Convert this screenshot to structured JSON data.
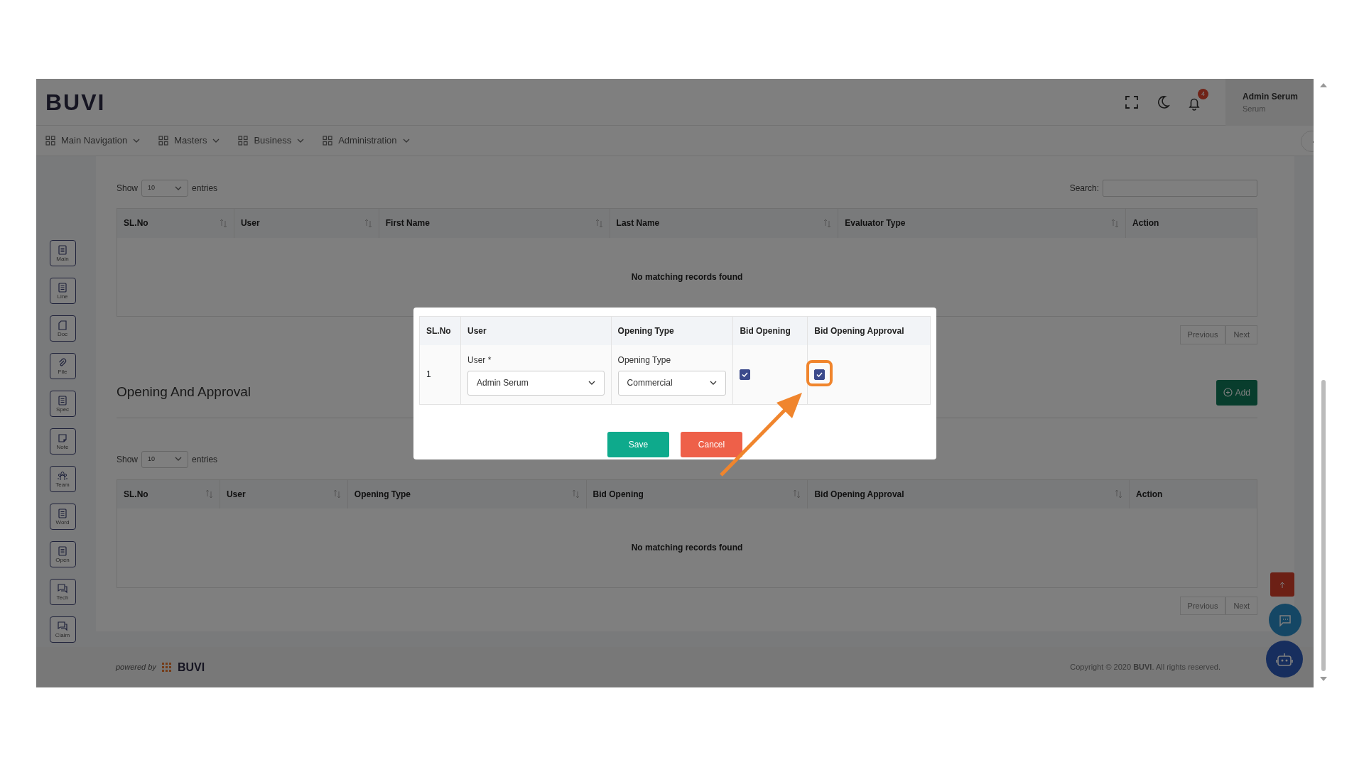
{
  "header": {
    "logo": "BUVI",
    "notification_count": "4",
    "user_name": "Admin Serum",
    "user_role": "Serum"
  },
  "nav": [
    {
      "label": "Main Navigation"
    },
    {
      "label": "Masters"
    },
    {
      "label": "Business"
    },
    {
      "label": "Administration"
    }
  ],
  "sidebar": [
    {
      "label": "Main",
      "kind": "list"
    },
    {
      "label": "Line",
      "kind": "list"
    },
    {
      "label": "Doc",
      "kind": "page"
    },
    {
      "label": "File",
      "kind": "clip"
    },
    {
      "label": "Spec",
      "kind": "list"
    },
    {
      "label": "Note",
      "kind": "note"
    },
    {
      "label": "Team",
      "kind": "team"
    },
    {
      "label": "Word",
      "kind": "list"
    },
    {
      "label": "Open",
      "kind": "list"
    },
    {
      "label": "Tech",
      "kind": "chat"
    },
    {
      "label": "Claim",
      "kind": "chat"
    }
  ],
  "evaluators": {
    "show_label": "Show",
    "page_size": "10",
    "entries_label": "entries",
    "search_label": "Search:",
    "columns": [
      {
        "label": "SL.No",
        "sortable": true
      },
      {
        "label": "User",
        "sortable": true
      },
      {
        "label": "First Name",
        "sortable": true
      },
      {
        "label": "Last Name",
        "sortable": true
      },
      {
        "label": "Evaluator Type",
        "sortable": true
      },
      {
        "label": "Action",
        "sortable": false
      }
    ],
    "empty_message": "No matching records found",
    "pager": [
      "Previous",
      "Next"
    ]
  },
  "opening": {
    "title": "Opening And Approval",
    "add_button": "Add",
    "show_label": "Show",
    "page_size": "10",
    "entries_label": "entries",
    "columns": [
      {
        "label": "SL.No",
        "sortable": true
      },
      {
        "label": "User",
        "sortable": true
      },
      {
        "label": "Opening Type",
        "sortable": true
      },
      {
        "label": "Bid Opening",
        "sortable": true
      },
      {
        "label": "Bid Opening Approval",
        "sortable": true
      },
      {
        "label": "Action",
        "sortable": false
      }
    ],
    "empty_message": "No matching records found",
    "pager": [
      "Previous",
      "Next"
    ]
  },
  "modal": {
    "columns": [
      "SL.No",
      "User",
      "Opening Type",
      "Bid Opening",
      "Bid Opening Approval"
    ],
    "rows": [
      {
        "sl_no": "1",
        "user_label": "User *",
        "user_value": "Admin Serum",
        "type_label": "Opening Type",
        "type_value": "Commercial",
        "bid_opening": true,
        "bid_opening_approval": true
      }
    ],
    "buttons": [
      {
        "label": "Save",
        "kind": "save"
      },
      {
        "label": "Cancel",
        "kind": "cancel"
      }
    ]
  },
  "footer": {
    "powered_by": "powered by",
    "brand": "BUVI",
    "copyright": "Copyright © 2020 **BUVI**. All rights reserved."
  }
}
